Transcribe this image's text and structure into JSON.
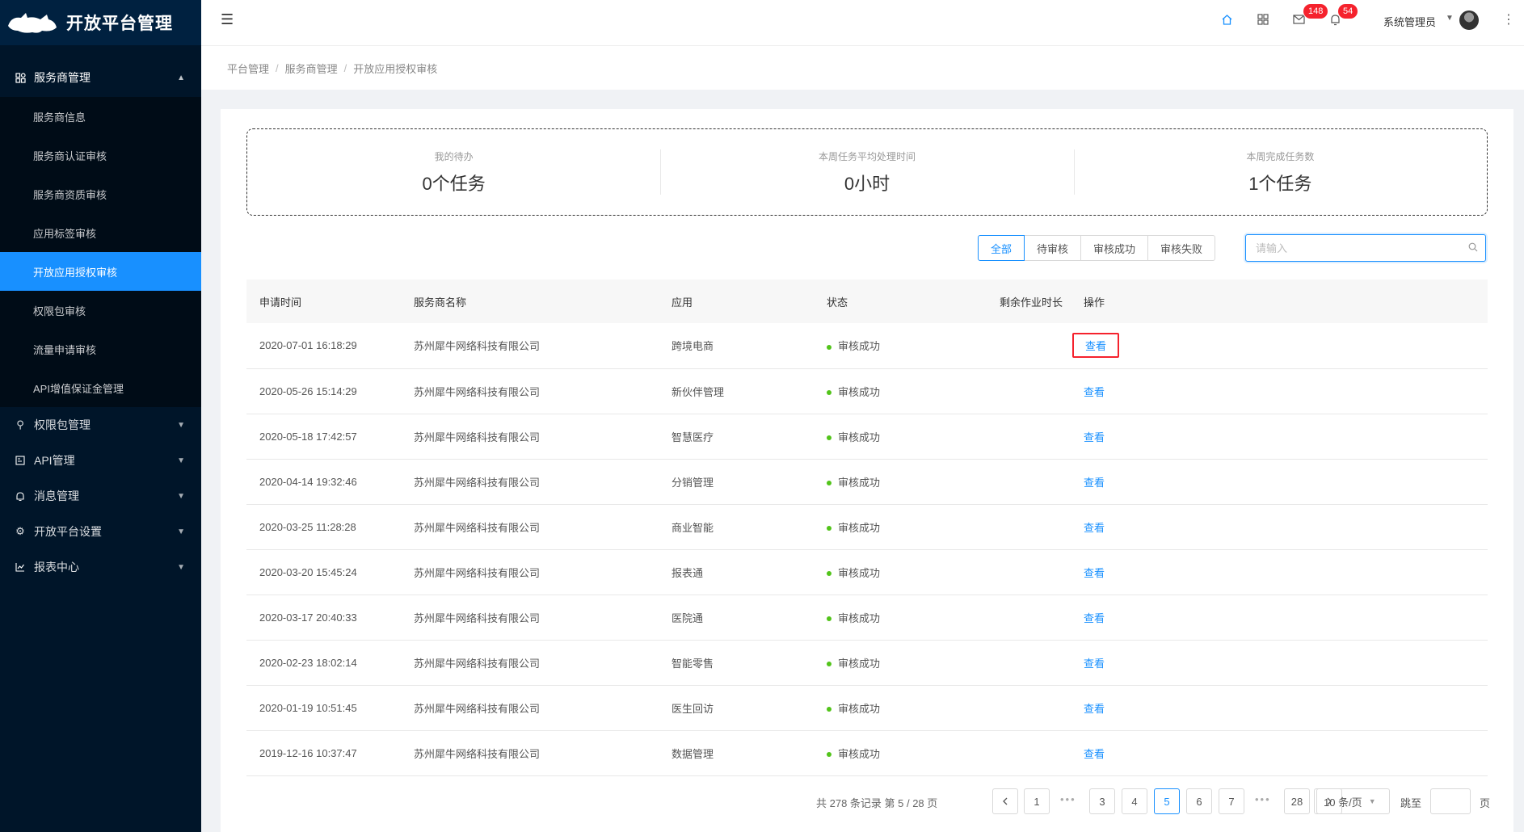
{
  "app": {
    "title": "开放平台管理"
  },
  "sidebar": {
    "group": {
      "label": "服务商管理",
      "items": [
        {
          "label": "服务商信息"
        },
        {
          "label": "服务商认证审核"
        },
        {
          "label": "服务商资质审核"
        },
        {
          "label": "应用标签审核"
        },
        {
          "label": "开放应用授权审核"
        },
        {
          "label": "权限包审核"
        },
        {
          "label": "流量申请审核"
        },
        {
          "label": "API增值保证金管理"
        }
      ]
    },
    "menus": [
      {
        "label": "权限包管理"
      },
      {
        "label": "API管理"
      },
      {
        "label": "消息管理"
      },
      {
        "label": "开放平台设置"
      },
      {
        "label": "报表中心"
      }
    ]
  },
  "header": {
    "mail_badge": "148",
    "bell_badge": "54",
    "user_name": "系统管理员"
  },
  "breadcrumb": [
    "平台管理",
    "服务商管理",
    "开放应用授权审核"
  ],
  "stats": [
    {
      "label": "我的待办",
      "value": "0个任务"
    },
    {
      "label": "本周任务平均处理时间",
      "value": "0小时"
    },
    {
      "label": "本周完成任务数",
      "value": "1个任务"
    }
  ],
  "filters": [
    "全部",
    "待审核",
    "审核成功",
    "审核失败"
  ],
  "search": {
    "placeholder": "请输入"
  },
  "table": {
    "columns": [
      "申请时间",
      "服务商名称",
      "应用",
      "状态",
      "剩余作业时长",
      "操作"
    ],
    "rows": [
      {
        "time": "2020-07-01 16:18:29",
        "vendor": "苏州犀牛网络科技有限公司",
        "app": "跨境电商",
        "status": "审核成功",
        "action": "查看"
      },
      {
        "time": "2020-05-26 15:14:29",
        "vendor": "苏州犀牛网络科技有限公司",
        "app": "新伙伴管理",
        "status": "审核成功",
        "action": "查看"
      },
      {
        "time": "2020-05-18 17:42:57",
        "vendor": "苏州犀牛网络科技有限公司",
        "app": "智慧医疗",
        "status": "审核成功",
        "action": "查看"
      },
      {
        "time": "2020-04-14 19:32:46",
        "vendor": "苏州犀牛网络科技有限公司",
        "app": "分销管理",
        "status": "审核成功",
        "action": "查看"
      },
      {
        "time": "2020-03-25 11:28:28",
        "vendor": "苏州犀牛网络科技有限公司",
        "app": "商业智能",
        "status": "审核成功",
        "action": "查看"
      },
      {
        "time": "2020-03-20 15:45:24",
        "vendor": "苏州犀牛网络科技有限公司",
        "app": "报表通",
        "status": "审核成功",
        "action": "查看"
      },
      {
        "time": "2020-03-17 20:40:33",
        "vendor": "苏州犀牛网络科技有限公司",
        "app": "医院通",
        "status": "审核成功",
        "action": "查看"
      },
      {
        "time": "2020-02-23 18:02:14",
        "vendor": "苏州犀牛网络科技有限公司",
        "app": "智能零售",
        "status": "审核成功",
        "action": "查看"
      },
      {
        "time": "2020-01-19 10:51:45",
        "vendor": "苏州犀牛网络科技有限公司",
        "app": "医生回访",
        "status": "审核成功",
        "action": "查看"
      },
      {
        "time": "2019-12-16 10:37:47",
        "vendor": "苏州犀牛网络科技有限公司",
        "app": "数据管理",
        "status": "审核成功",
        "action": "查看"
      }
    ]
  },
  "pagination": {
    "total_text": "共 278 条记录 第 5 / 28 页",
    "pages": [
      "1",
      "3",
      "4",
      "5",
      "6",
      "7",
      "28"
    ],
    "current": "5",
    "page_size": "10 条/页",
    "jump_label": "跳至",
    "page_suffix": "页"
  }
}
